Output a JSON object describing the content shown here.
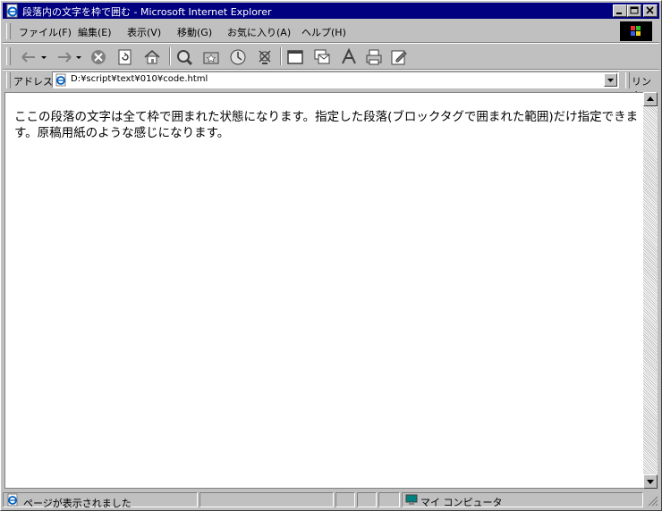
{
  "window": {
    "title": "段落内の文字を枠で囲む - Microsoft Internet Explorer"
  },
  "menu": {
    "items": [
      "ファイル(F)",
      "編集(E)",
      "表示(V)",
      "移動(G)",
      "お気に入り(A)",
      "ヘルプ(H)"
    ]
  },
  "toolbar": {
    "icons": [
      "back-icon",
      "forward-icon",
      "stop-icon",
      "refresh-icon",
      "home-icon",
      "search-icon",
      "favorites-icon",
      "history-icon",
      "channels-icon",
      "fullscreen-icon",
      "mail-icon",
      "font-icon",
      "print-icon",
      "edit-icon"
    ]
  },
  "address": {
    "label": "アドレス",
    "value": "D:¥script¥text¥010¥code.html",
    "links_label": "リンク"
  },
  "content": {
    "text": "ここの段落の文字は全て枠で囲まれた状態になります。指定した段落(ブロックタグで囲まれた範囲)だけ指定できます。原稿用紙のような感じになります。"
  },
  "status": {
    "text": "ページが表示されました",
    "zone": "マイ コンピュータ"
  },
  "colors": {
    "titlebar": "#000080",
    "face": "#c0c0c0"
  }
}
